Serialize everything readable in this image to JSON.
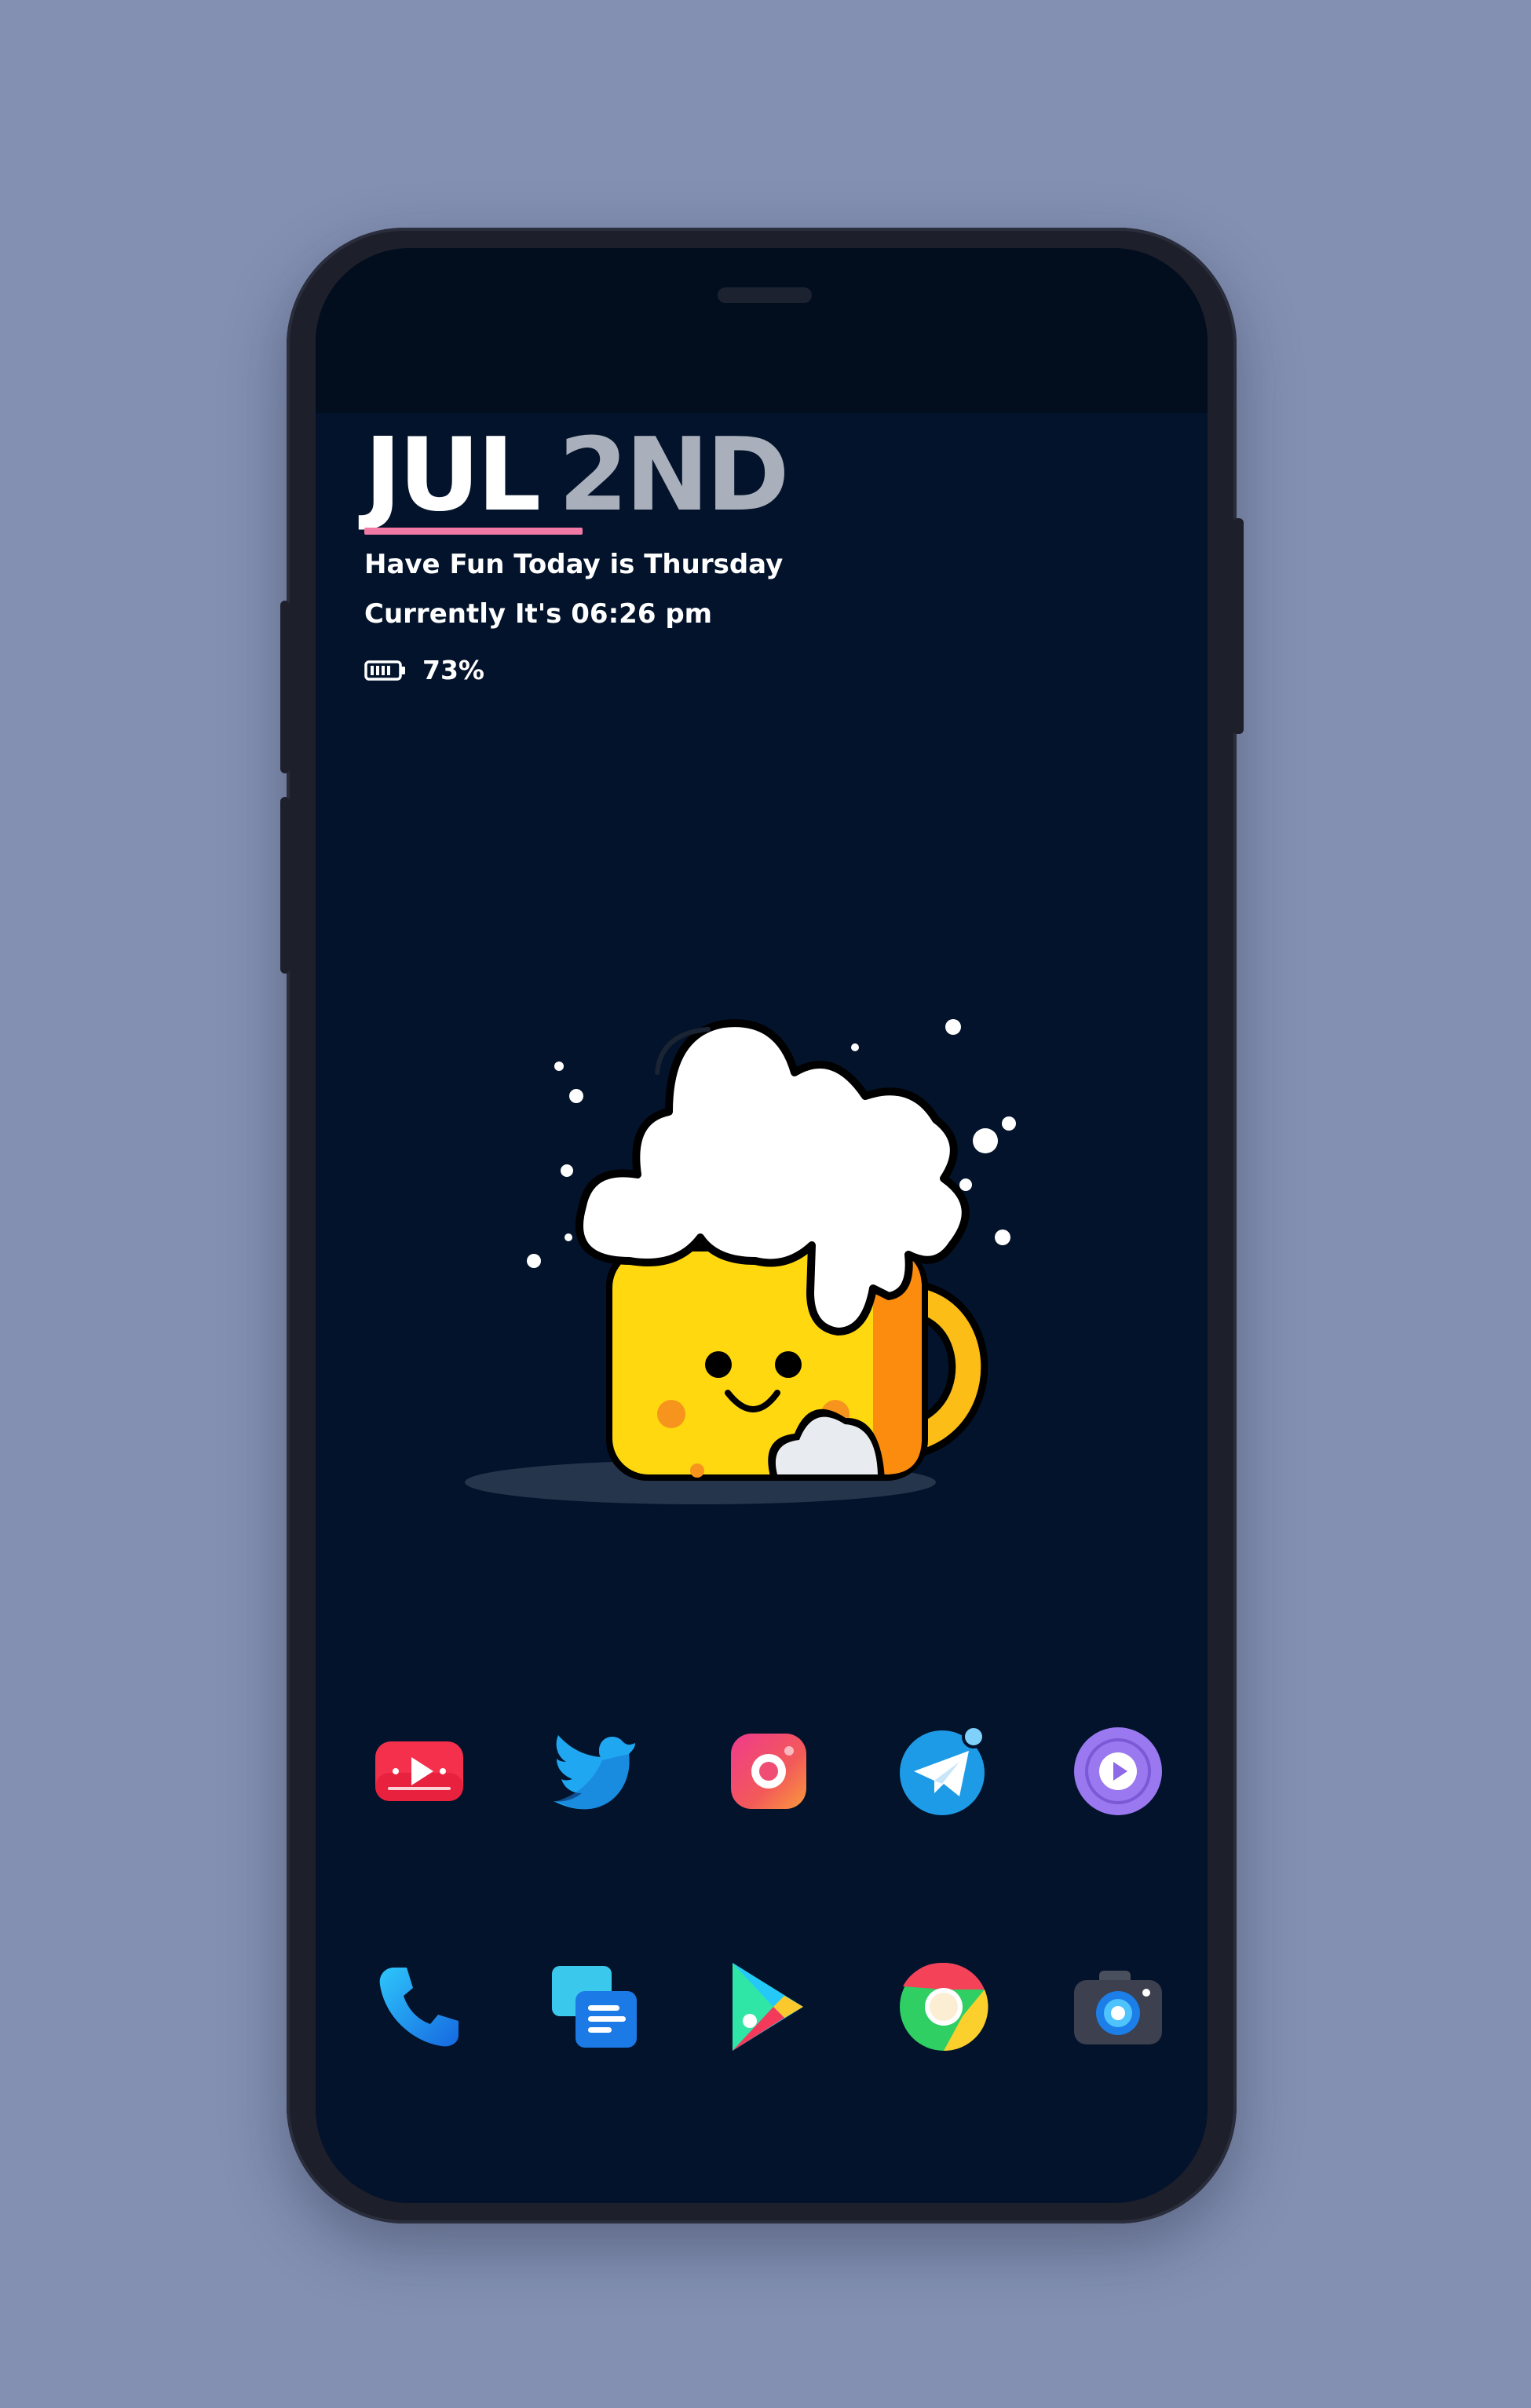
{
  "widget": {
    "month": "JUL",
    "day": "2ND",
    "greeting": "Have Fun Today is Thursday",
    "time_line": "Currently It's 06:26 pm",
    "battery": "73%"
  },
  "colors": {
    "background": "#8390b2",
    "screen": "#03132b",
    "accent_underline": "#f07aa5",
    "day_text": "#aab0bb"
  },
  "wallpaper": {
    "subject": "smiling-beer-mug-illustration"
  },
  "dock": {
    "row1": [
      {
        "icon": "youtube-icon"
      },
      {
        "icon": "twitter-icon"
      },
      {
        "icon": "instagram-icon"
      },
      {
        "icon": "telegram-icon"
      },
      {
        "icon": "video-player-icon"
      }
    ],
    "row2": [
      {
        "icon": "phone-icon"
      },
      {
        "icon": "messages-icon"
      },
      {
        "icon": "play-store-icon"
      },
      {
        "icon": "chrome-icon"
      },
      {
        "icon": "camera-icon"
      }
    ]
  }
}
